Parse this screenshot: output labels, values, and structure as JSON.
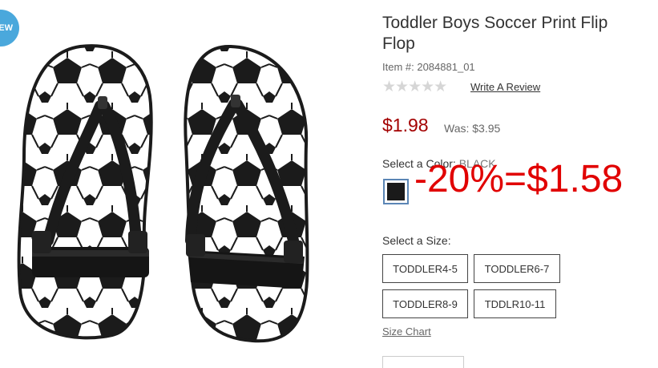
{
  "badge": {
    "label": "EW"
  },
  "product": {
    "title": "Toddler Boys Soccer Print Flip Flop",
    "item_number": "Item #: 2084881_01",
    "rating_stars": "★★★★★",
    "write_review": "Write A Review",
    "price": "$1.98",
    "was_price": "Was: $3.95",
    "promo_annotation": "-20%=$1.58",
    "color_label": "Select a Color:",
    "color_value": "BLACK",
    "size_label": "Select a Size:",
    "sizes": [
      "TODDLER4-5",
      "TODDLER6-7",
      "TODDLER8-9",
      "TDDLR10-11"
    ],
    "size_chart": "Size Chart"
  },
  "colors": {
    "price": "#a30000",
    "promo": "#e10000",
    "badge": "#4aa8dc",
    "swatch": "#1a1a1a",
    "swatch_border": "#5b86b5"
  }
}
